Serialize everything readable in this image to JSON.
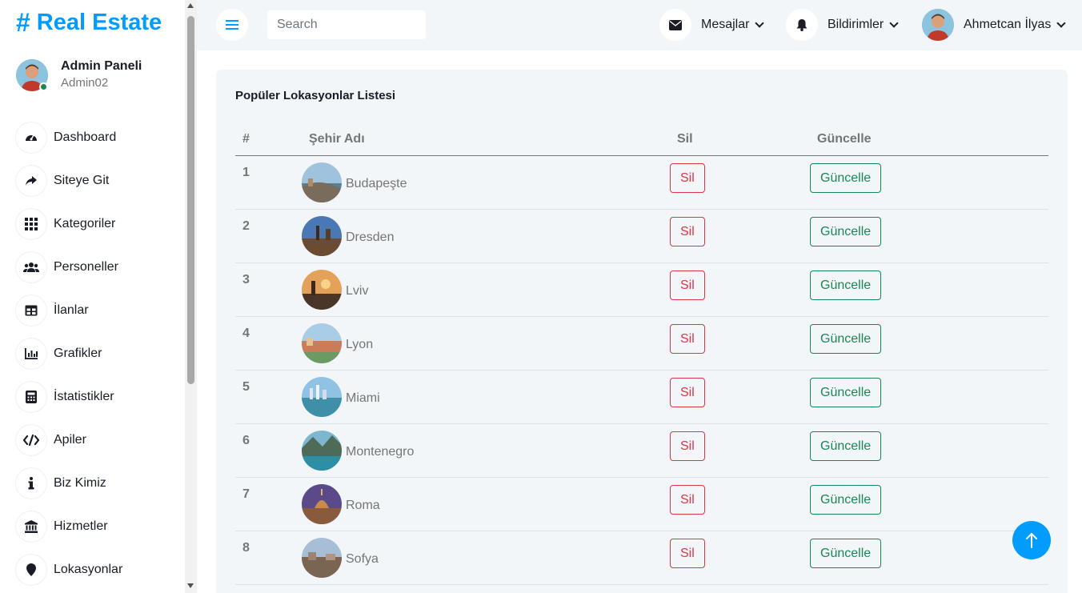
{
  "brand": {
    "symbol": "#",
    "name": "Real Estate"
  },
  "profile": {
    "name": "Admin Paneli",
    "role": "Admin02"
  },
  "sidebar": {
    "items": [
      {
        "label": "Dashboard",
        "icon": "dashboard-icon"
      },
      {
        "label": "Siteye Git",
        "icon": "share-arrow-icon"
      },
      {
        "label": "Kategoriler",
        "icon": "grid-icon"
      },
      {
        "label": "Personeller",
        "icon": "users-icon"
      },
      {
        "label": "İlanlar",
        "icon": "table-icon"
      },
      {
        "label": "Grafikler",
        "icon": "chart-icon"
      },
      {
        "label": "İstatistikler",
        "icon": "calculator-icon"
      },
      {
        "label": "Apiler",
        "icon": "code-icon"
      },
      {
        "label": "Biz Kimiz",
        "icon": "info-icon"
      },
      {
        "label": "Hizmetler",
        "icon": "bank-icon"
      },
      {
        "label": "Lokasyonlar",
        "icon": "map-pin-icon"
      }
    ]
  },
  "topbar": {
    "search_placeholder": "Search",
    "messages_label": "Mesajlar",
    "notifications_label": "Bildirimler",
    "user_name": "Ahmetcan İlyas"
  },
  "main": {
    "title": "Popüler Lokasyonlar Listesi",
    "columns": {
      "num": "#",
      "city": "Şehir Adı",
      "delete": "Sil",
      "update": "Güncelle"
    },
    "rows": [
      {
        "num": "1",
        "city": "Budapeşte",
        "delete": "Sil",
        "update": "Güncelle"
      },
      {
        "num": "2",
        "city": "Dresden",
        "delete": "Sil",
        "update": "Güncelle"
      },
      {
        "num": "3",
        "city": "Lviv",
        "delete": "Sil",
        "update": "Güncelle"
      },
      {
        "num": "4",
        "city": "Lyon",
        "delete": "Sil",
        "update": "Güncelle"
      },
      {
        "num": "5",
        "city": "Miami",
        "delete": "Sil",
        "update": "Güncelle"
      },
      {
        "num": "6",
        "city": "Montenegro",
        "delete": "Sil",
        "update": "Güncelle"
      },
      {
        "num": "7",
        "city": "Roma",
        "delete": "Sil",
        "update": "Güncelle"
      },
      {
        "num": "8",
        "city": "Sofya",
        "delete": "Sil",
        "update": "Güncelle"
      }
    ]
  },
  "colors": {
    "accent": "#009cff",
    "danger": "#dc3545",
    "success": "#198754",
    "online": "#198754"
  }
}
